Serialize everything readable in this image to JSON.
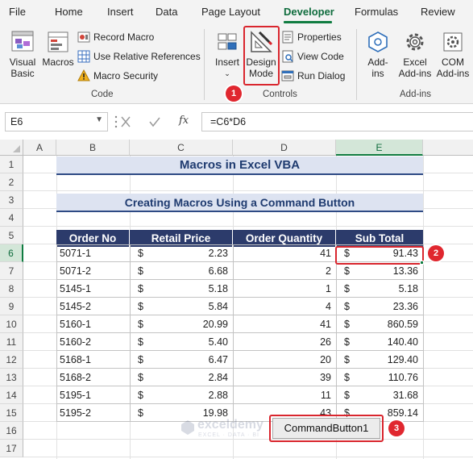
{
  "ribbon_tabs": [
    {
      "label": "File",
      "active": false
    },
    {
      "label": "Home",
      "active": false
    },
    {
      "label": "Insert",
      "active": false
    },
    {
      "label": "Data",
      "active": false
    },
    {
      "label": "Page Layout",
      "active": false
    },
    {
      "label": "Developer",
      "active": true
    },
    {
      "label": "Formulas",
      "active": false
    },
    {
      "label": "Review",
      "active": false
    }
  ],
  "groups": {
    "code": {
      "label": "Code",
      "visual_basic": [
        "Visual",
        "Basic"
      ],
      "macros": "Macros",
      "record_macro": "Record Macro",
      "use_relative_references": "Use Relative References",
      "macro_security": "Macro Security"
    },
    "controls": {
      "label": "Controls",
      "insert": "Insert",
      "design_mode": [
        "Design",
        "Mode"
      ],
      "properties": "Properties",
      "view_code": "View Code",
      "run_dialog": "Run Dialog"
    },
    "addins": {
      "label": "Add-ins",
      "addins": [
        "Add-",
        "ins"
      ],
      "excel_addins": [
        "Excel",
        "Add-ins"
      ],
      "com_addins": [
        "COM",
        "Add-ins"
      ]
    }
  },
  "callouts": [
    "1",
    "2",
    "3"
  ],
  "formula_bar": {
    "name_box": "E6",
    "fx_label": "fx",
    "formula": "=C6*D6"
  },
  "sheet": {
    "columns": [
      "A",
      "B",
      "C",
      "D",
      "E"
    ],
    "selected_column": "E",
    "rows": [
      "1",
      "2",
      "3",
      "4",
      "5",
      "6",
      "7",
      "8",
      "9",
      "10",
      "11",
      "12",
      "13",
      "14",
      "15",
      "16",
      "17"
    ],
    "selected_row": "6",
    "title": "Macros in Excel VBA",
    "subtitle": "Creating Macros Using a Command Button",
    "table_headers": [
      "Order No",
      "Retail Price",
      "Order Quantity",
      "Sub Total"
    ],
    "currency_symbol": "$",
    "table_rows": [
      {
        "order_no": "5071-1",
        "retail_price": "2.23",
        "quantity": "41",
        "sub_total": "91.43"
      },
      {
        "order_no": "5071-2",
        "retail_price": "6.68",
        "quantity": "2",
        "sub_total": "13.36"
      },
      {
        "order_no": "5145-1",
        "retail_price": "5.18",
        "quantity": "1",
        "sub_total": "5.18"
      },
      {
        "order_no": "5145-2",
        "retail_price": "5.84",
        "quantity": "4",
        "sub_total": "23.36"
      },
      {
        "order_no": "5160-1",
        "retail_price": "20.99",
        "quantity": "41",
        "sub_total": "860.59"
      },
      {
        "order_no": "5160-2",
        "retail_price": "5.40",
        "quantity": "26",
        "sub_total": "140.40"
      },
      {
        "order_no": "5168-1",
        "retail_price": "6.47",
        "quantity": "20",
        "sub_total": "129.40"
      },
      {
        "order_no": "5168-2",
        "retail_price": "2.84",
        "quantity": "39",
        "sub_total": "110.76"
      },
      {
        "order_no": "5195-1",
        "retail_price": "2.88",
        "quantity": "11",
        "sub_total": "31.68"
      },
      {
        "order_no": "5195-2",
        "retail_price": "19.98",
        "quantity": "43",
        "sub_total": "859.14"
      }
    ],
    "command_button": "CommandButton1"
  },
  "watermark": {
    "brand": "exceldemy",
    "tagline": "EXCEL · DATA · BI"
  },
  "colors": {
    "accent_green": "#107c41",
    "header_navy": "#2c3b6b",
    "banner_fill": "#dde3f1",
    "callout_red": "#e0272f"
  }
}
